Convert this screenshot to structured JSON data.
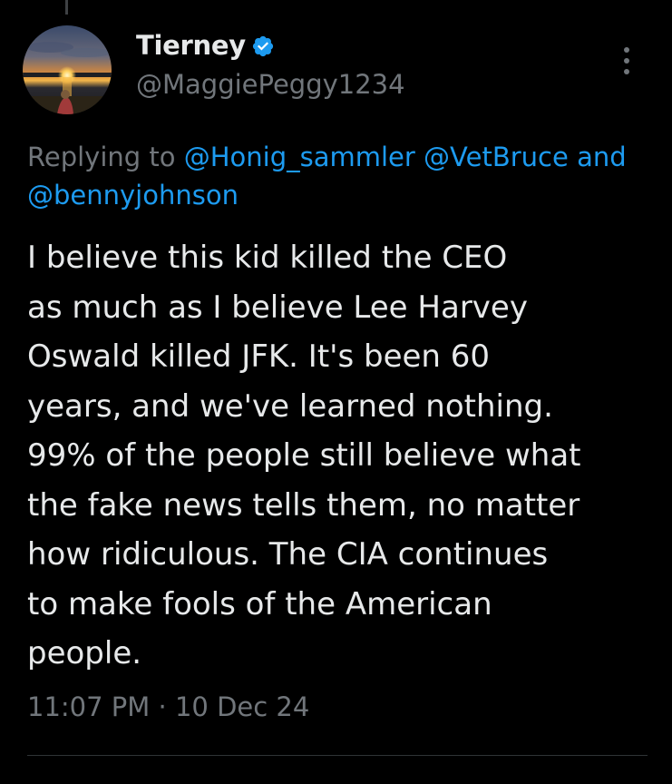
{
  "tweet": {
    "author": {
      "display_name": "Tierney",
      "handle": "@MaggiePeggy1234",
      "verified": true,
      "avatar_icon": "avatar-sunset-lake-photo"
    },
    "reply": {
      "prefix": "Replying to",
      "mentions": [
        "@Honig_sammler",
        "@VetBruce"
      ],
      "suffix": "and",
      "second_line": "@bennyjohnson"
    },
    "text_lines": [
      "I believe this kid killed the CEO",
      "as much as I believe Lee Harvey",
      "Oswald killed JFK. It's been 60",
      "years, and we've learned nothing.",
      "99% of the people still believe what",
      "the fake news tells them, no matter",
      "how ridiculous. The CIA continues",
      "to make fools of the American",
      "people."
    ],
    "time": "11:07 PM",
    "separator": "·",
    "date": "10 Dec 24"
  },
  "icons": {
    "verified": "verified-badge-icon",
    "more": "more-options-icon"
  },
  "colors": {
    "background": "#000000",
    "primary_text": "#e7e9ea",
    "secondary_text": "#71767b",
    "link": "#1d9bf0",
    "verified_badge": "#1d9bf0",
    "divider": "#2f3336"
  }
}
